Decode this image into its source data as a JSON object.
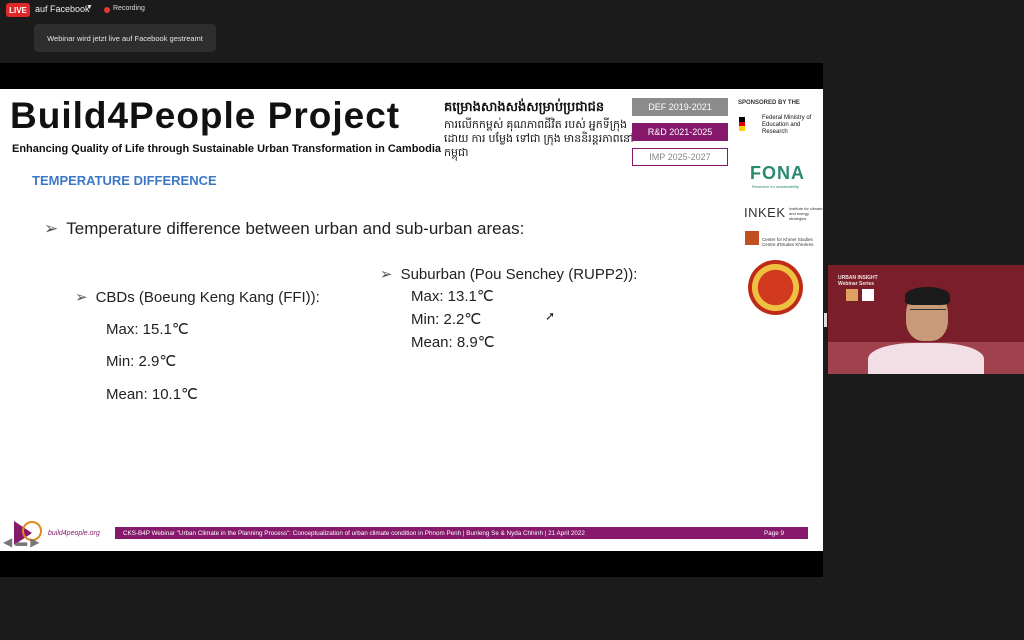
{
  "topbar": {
    "live_badge": "LIVE",
    "stream_target": "auf Facebook",
    "recording_label": "Recording"
  },
  "tooltip": {
    "text": "Webinar wird jetzt live auf Facebook gestreamt"
  },
  "slide": {
    "title": "Build4People Project",
    "subtitle": "Enhancing Quality of Life through Sustainable Urban Transformation in Cambodia",
    "khmer_title": "គម្រោងសាងសង់សម្រាប់ប្រជាជន",
    "khmer_subtitle": "ការលើកកម្ពស់ គុណភាពជីវិត របស់ អ្នកទីក្រុង ដោយ ការ បម្លែង ទៅជា ក្រុង មាននិរន្តរភាពនៅកម្ពុជា",
    "phases": [
      "DEF 2019-2021",
      "R&D 2021-2025",
      "IMP 2025-2027"
    ],
    "sponsored_by": "SPONSORED BY THE",
    "bmbf": "Federal Ministry of Education and Research",
    "fona": "FONA",
    "fona_sub": "Research for sustainability",
    "inkek": "INKEK",
    "inkek_sub": "Institute for climate and energy strategies",
    "cks": "Center for Khmer Studies",
    "cks_sub": "Centre d'Etudes Khmères",
    "heading": "TEMPERATURE DIFFERENCE",
    "main_bullet": "Temperature difference between urban and sub-urban areas:",
    "cbd": {
      "label": "CBDs (Boeung Keng Kang (FFI)):",
      "max": "Max: 15.1℃",
      "min": "Min: 2.9℃",
      "mean": "Mean: 10.1℃"
    },
    "suburban": {
      "label": "Suburban (Pou Senchey (RUPP2)):",
      "max": "Max: 13.1℃",
      "min": "Min: 2.2℃",
      "mean": "Mean: 8.9℃"
    },
    "website": "build4people.org",
    "footer_text": "CKS-B4P Webinar \"Urban Climate in the Planning Process\": Conceptualization of urban climate condition in Phnom Penh | Bunleng Se & Nyda Chhinh | 21 April 2022",
    "page": "Page 9"
  },
  "video": {
    "series_title": "URBAN INSIGHT",
    "series_sub": "Webinar Series"
  },
  "colors": {
    "accent": "#86196b",
    "heading": "#3b78c6",
    "live": "#e02828"
  }
}
